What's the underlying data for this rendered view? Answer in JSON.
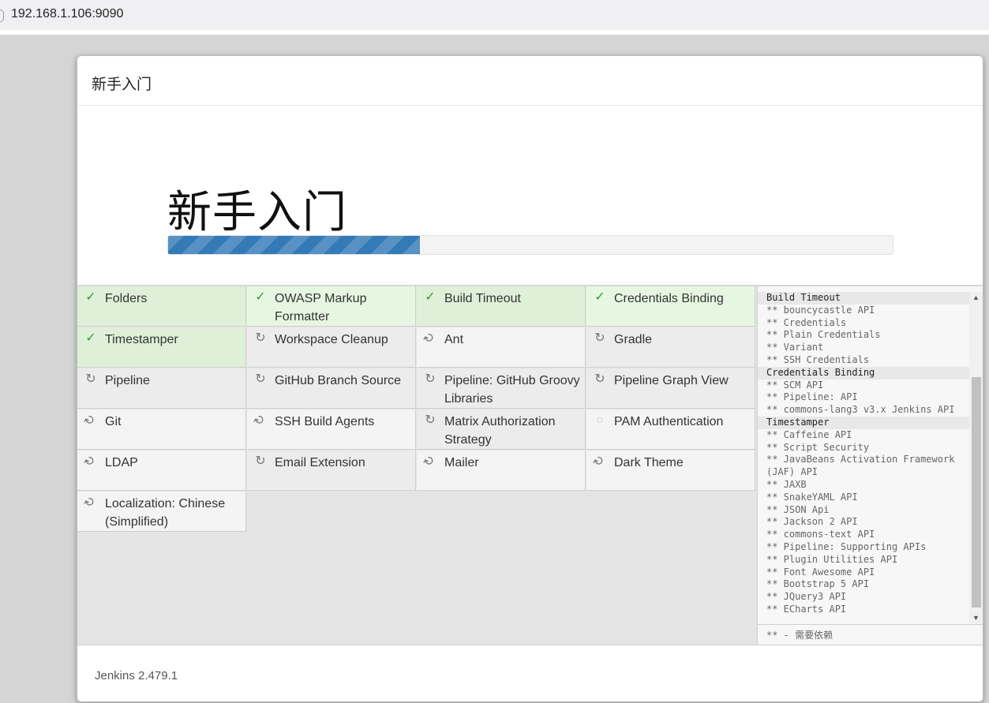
{
  "browser": {
    "url": "192.168.1.106:9090"
  },
  "dialog": {
    "header_title": "新手入门",
    "hero_title": "新手入门",
    "progress_percent": 34.8
  },
  "plugins": [
    {
      "name": "Folders",
      "status": "done",
      "icon": "check-icon"
    },
    {
      "name": "OWASP Markup Formatter",
      "status": "done-light",
      "icon": "check-icon"
    },
    {
      "name": "Build Timeout",
      "status": "done",
      "icon": "check-icon"
    },
    {
      "name": "Credentials Binding",
      "status": "done-light",
      "icon": "check-icon"
    },
    {
      "name": "Timestamper",
      "status": "done",
      "icon": "check-icon"
    },
    {
      "name": "Workspace Cleanup",
      "status": "pending",
      "icon": "refresh-icon"
    },
    {
      "name": "Ant",
      "status": "installing",
      "icon": "spinner-icon"
    },
    {
      "name": "Gradle",
      "status": "pending",
      "icon": "refresh-icon"
    },
    {
      "name": "Pipeline",
      "status": "pending",
      "icon": "refresh-icon"
    },
    {
      "name": "GitHub Branch Source",
      "status": "pending",
      "icon": "refresh-icon"
    },
    {
      "name": "Pipeline: GitHub Groovy Libraries",
      "status": "pending",
      "icon": "refresh-icon"
    },
    {
      "name": "Pipeline Graph View",
      "status": "pending",
      "icon": "refresh-icon"
    },
    {
      "name": "Git",
      "status": "installing",
      "icon": "spinner-icon"
    },
    {
      "name": "SSH Build Agents",
      "status": "installing",
      "icon": "spinner-icon"
    },
    {
      "name": "Matrix Authorization Strategy",
      "status": "pending",
      "icon": "refresh-icon"
    },
    {
      "name": "PAM Authentication",
      "status": "waiting",
      "icon": "circle-icon"
    },
    {
      "name": "LDAP",
      "status": "installing",
      "icon": "spinner-icon"
    },
    {
      "name": "Email Extension",
      "status": "pending",
      "icon": "refresh-icon"
    },
    {
      "name": "Mailer",
      "status": "installing",
      "icon": "spinner-icon"
    },
    {
      "name": "Dark Theme",
      "status": "installing",
      "icon": "spinner-icon"
    },
    {
      "name": "Localization: Chinese (Simplified)",
      "status": "installing",
      "icon": "spinner-icon"
    }
  ],
  "log": {
    "lines": [
      {
        "type": "hdr",
        "text": "Build Timeout"
      },
      {
        "type": "dep",
        "text": "** bouncycastle API"
      },
      {
        "type": "dep",
        "text": "** Credentials"
      },
      {
        "type": "dep",
        "text": "** Plain Credentials"
      },
      {
        "type": "dep",
        "text": "** Variant"
      },
      {
        "type": "dep",
        "text": "** SSH Credentials"
      },
      {
        "type": "hdr",
        "text": "Credentials Binding"
      },
      {
        "type": "dep",
        "text": "** SCM API"
      },
      {
        "type": "dep",
        "text": "** Pipeline: API"
      },
      {
        "type": "dep",
        "text": "** commons-lang3 v3.x Jenkins API"
      },
      {
        "type": "hdr",
        "text": "Timestamper"
      },
      {
        "type": "dep",
        "text": "** Caffeine API"
      },
      {
        "type": "dep",
        "text": "** Script Security"
      },
      {
        "type": "dep",
        "text": "** JavaBeans Activation Framework (JAF) API"
      },
      {
        "type": "dep",
        "text": "** JAXB"
      },
      {
        "type": "dep",
        "text": "** SnakeYAML API"
      },
      {
        "type": "dep",
        "text": "** JSON Api"
      },
      {
        "type": "dep",
        "text": "** Jackson 2 API"
      },
      {
        "type": "dep",
        "text": "** commons-text API"
      },
      {
        "type": "dep",
        "text": "** Pipeline: Supporting APIs"
      },
      {
        "type": "dep",
        "text": "** Plugin Utilities API"
      },
      {
        "type": "dep",
        "text": "** Font Awesome API"
      },
      {
        "type": "dep",
        "text": "** Bootstrap 5 API"
      },
      {
        "type": "dep",
        "text": "** JQuery3 API"
      },
      {
        "type": "dep",
        "text": "** ECharts API"
      }
    ],
    "footer": "** - 需要依赖"
  },
  "footer": {
    "version": "Jenkins 2.479.1"
  }
}
